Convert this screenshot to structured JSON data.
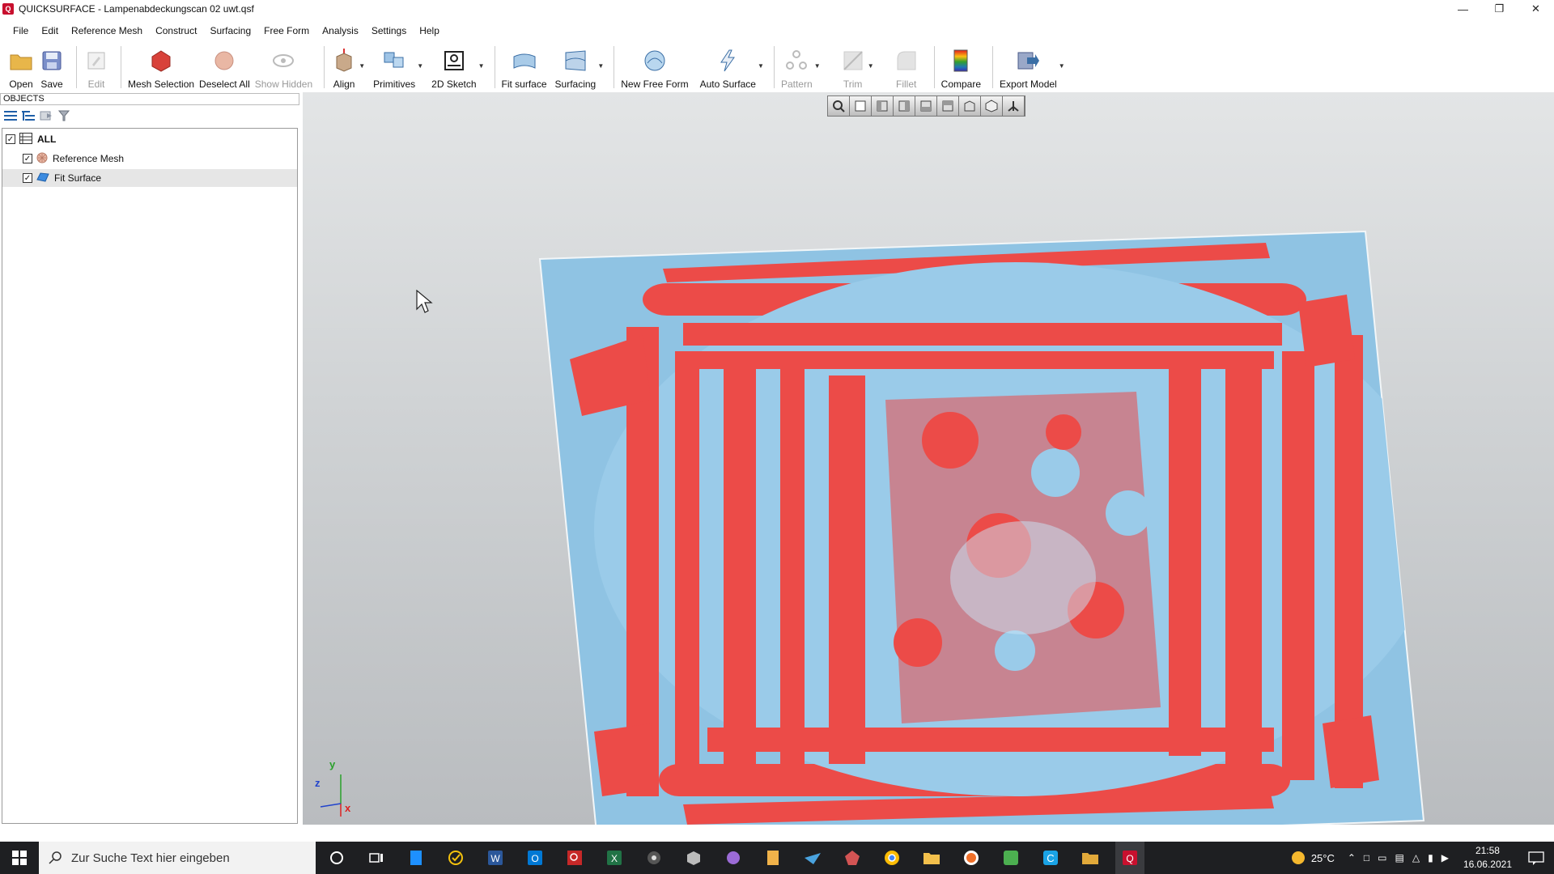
{
  "window": {
    "title": "QUICKSURFACE - Lampenabdeckungscan 02 uwt.qsf",
    "app_icon_text": "Q"
  },
  "menu": [
    "File",
    "Edit",
    "Reference Mesh",
    "Construct",
    "Surfacing",
    "Free Form",
    "Analysis",
    "Settings",
    "Help"
  ],
  "toolbar": {
    "open": "Open",
    "save": "Save",
    "edit": "Edit",
    "mesh_selection": "Mesh Selection",
    "deselect_all": "Deselect All",
    "show_hidden": "Show Hidden",
    "align": "Align",
    "primitives": "Primitives",
    "sketch2d": "2D Sketch",
    "fit_surface": "Fit surface",
    "surfacing": "Surfacing",
    "new_free_form": "New Free Form",
    "auto_surface": "Auto Surface",
    "pattern": "Pattern",
    "trim": "Trim",
    "fillet": "Fillet",
    "compare": "Compare",
    "export_model": "Export Model"
  },
  "objects_panel": {
    "header": "OBJECTS",
    "items": [
      {
        "label": "ALL",
        "checked": true
      },
      {
        "label": "Reference Mesh",
        "checked": true
      },
      {
        "label": "Fit Surface",
        "checked": true,
        "selected": true
      }
    ]
  },
  "axes": {
    "y": "y",
    "z": "z",
    "x": "x"
  },
  "colors": {
    "surface_blue": "#8fc3e3",
    "deviation_red": "#ec4b48",
    "accent": "#c8102e"
  },
  "taskbar": {
    "search_placeholder": "Zur Suche Text hier eingeben",
    "weather": "25°C",
    "time": "21:58",
    "date": "16.06.2021"
  }
}
